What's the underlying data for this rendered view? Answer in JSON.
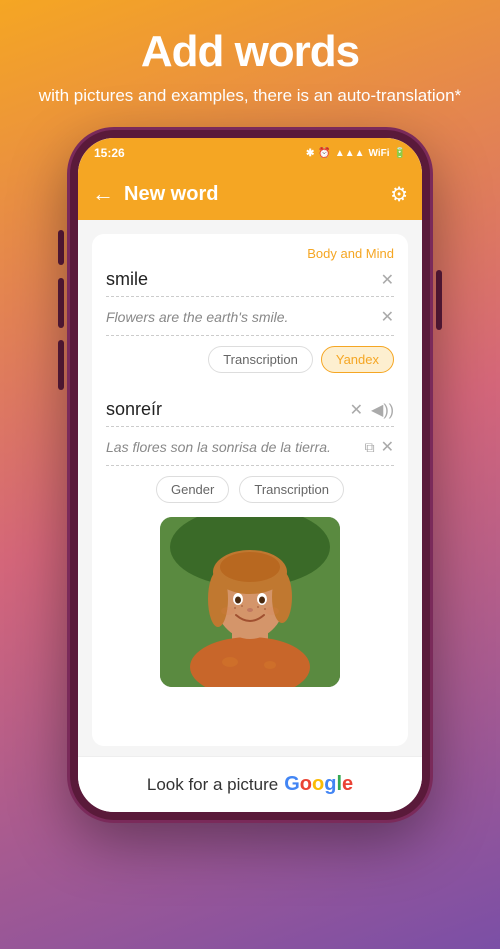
{
  "page": {
    "heading": "Add words",
    "subheading": "with pictures and examples,\nthere is an auto-translation*"
  },
  "status_bar": {
    "time": "15:26",
    "icons": "⁕ ⏰ .ull ᵛᵒ WiFi 🔋"
  },
  "header": {
    "back_label": "←",
    "title": "New word",
    "settings_icon": "⚙"
  },
  "category": "Body and Mind",
  "word_section": {
    "word": "smile",
    "example": "Flowers are the earth's smile.",
    "transcription_label": "Transcription",
    "yandex_label": "Yandex"
  },
  "translation_section": {
    "word": "sonreír",
    "example": "Las flores son la sonrisa de la tierra.",
    "gender_label": "Gender",
    "transcription_label": "Transcription"
  },
  "bottom": {
    "look_for": "Look for a picture",
    "google": "Google"
  }
}
